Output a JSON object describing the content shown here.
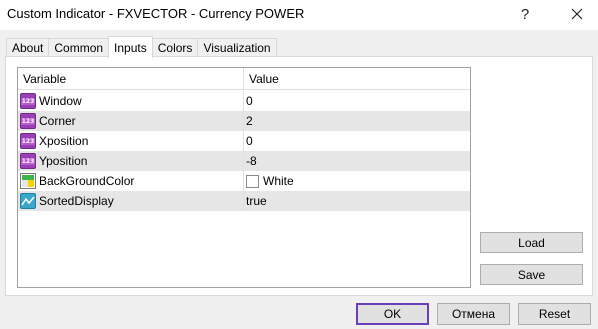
{
  "window": {
    "title": "Custom Indicator - FXVECTOR - Currency POWER",
    "help_label": "?",
    "close_icon": "close-icon"
  },
  "tabs": [
    {
      "label": "About",
      "active": false
    },
    {
      "label": "Common",
      "active": false
    },
    {
      "label": "Inputs",
      "active": true
    },
    {
      "label": "Colors",
      "active": false
    },
    {
      "label": "Visualization",
      "active": false
    }
  ],
  "grid": {
    "headers": {
      "variable": "Variable",
      "value": "Value"
    },
    "rows": [
      {
        "icon": "integer-123-icon",
        "name": "Window",
        "value": "0"
      },
      {
        "icon": "integer-123-icon",
        "name": "Corner",
        "value": "2"
      },
      {
        "icon": "integer-123-icon",
        "name": "Xposition",
        "value": "0"
      },
      {
        "icon": "integer-123-icon",
        "name": "Yposition",
        "value": "-8"
      },
      {
        "icon": "color-palette-icon",
        "name": "BackGroundColor",
        "value": "White",
        "swatch": "#ffffff"
      },
      {
        "icon": "boolean-chart-icon",
        "name": "SortedDisplay",
        "value": "true"
      }
    ]
  },
  "side_buttons": {
    "load": "Load",
    "save": "Save"
  },
  "footer_buttons": {
    "ok": "OK",
    "cancel": "Отмена",
    "reset": "Reset"
  },
  "colors": {
    "accent": "#6b3fb8",
    "row_alt": "#e6e6e6",
    "integer_icon": "#9b3fb5"
  }
}
